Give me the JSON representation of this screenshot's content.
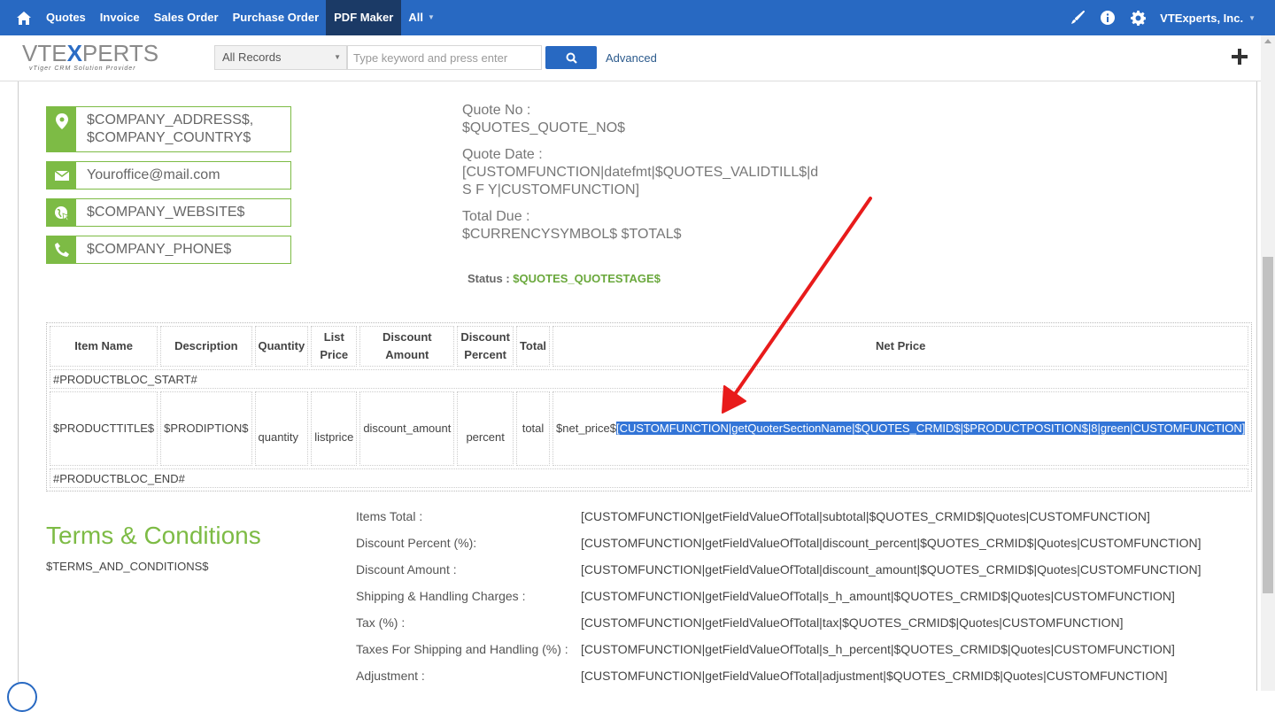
{
  "nav": {
    "items": [
      {
        "label": "Quotes"
      },
      {
        "label": "Invoice"
      },
      {
        "label": "Sales Order"
      },
      {
        "label": "Purchase Order"
      },
      {
        "label": "PDF Maker",
        "active": true
      },
      {
        "label": "All",
        "caret": true
      }
    ],
    "company": "VTExperts, Inc.",
    "icons": [
      "home-icon",
      "brush-icon",
      "info-icon",
      "gear-icon"
    ]
  },
  "subbar": {
    "logo_text_a": "VTE",
    "logo_text_x": "X",
    "logo_text_b": "PERTS",
    "logo_tagline": "vTiger CRM Solution Provider",
    "records_select": "All Records",
    "search_placeholder": "Type keyword and press enter",
    "advanced": "Advanced"
  },
  "contact": {
    "address_line1": "$COMPANY_ADDRESS$,",
    "address_line2": "$COMPANY_COUNTRY$",
    "email": "Youroffice@mail.com",
    "website": "$COMPANY_WEBSITE$",
    "phone": "$COMPANY_PHONE$"
  },
  "quote": {
    "no_label": "Quote No :",
    "no_value": "$QUOTES_QUOTE_NO$",
    "date_label": "Quote Date :",
    "date_value_1": "[CUSTOMFUNCTION|datefmt|$QUOTES_VALIDTILL$|d",
    "date_value_2": "S F Y|CUSTOMFUNCTION]",
    "due_label": "Total Due :",
    "due_value": "$CURRENCYSYMBOL$ $TOTAL$",
    "status_label": "Status :",
    "status_value": "$QUOTES_QUOTESTAGE$"
  },
  "table": {
    "headers": {
      "item_name": "Item Name",
      "description": "Description",
      "quantity": "Quantity",
      "list_price_1": "List",
      "list_price_2": "Price",
      "discount_amount_1": "Discount",
      "discount_amount_2": "Amount",
      "discount_percent_1": "Discount",
      "discount_percent_2": "Percent",
      "total": "Total",
      "net_price": "Net Price"
    },
    "bloc_start": "#PRODUCTBLOC_START#",
    "bloc_end": "#PRODUCTBLOC_END#",
    "row": {
      "title": "$PRODUCTTITLE$",
      "description": "$PRODIPTION$",
      "quantity": "quantity",
      "listprice": "listprice",
      "discount_amount": "discount_amount",
      "percent": "percent",
      "total": "total",
      "net_price_plain": "$net_price$",
      "net_price_selected": "[CUSTOMFUNCTION|getQuoterSectionName|$QUOTES_CRMID$|$PRODUCTPOSITION$|8|green|CUSTOMFUNCTION]"
    }
  },
  "terms": {
    "title": "Terms & Conditions",
    "value": "$TERMS_AND_CONDITIONS$"
  },
  "totals": [
    {
      "label": "Items Total :",
      "value": "[CUSTOMFUNCTION|getFieldValueOfTotal|subtotal|$QUOTES_CRMID$|Quotes|CUSTOMFUNCTION]"
    },
    {
      "label": "Discount Percent (%):",
      "value": "[CUSTOMFUNCTION|getFieldValueOfTotal|discount_percent|$QUOTES_CRMID$|Quotes|CUSTOMFUNCTION]"
    },
    {
      "label": "Discount Amount :",
      "value": "[CUSTOMFUNCTION|getFieldValueOfTotal|discount_amount|$QUOTES_CRMID$|Quotes|CUSTOMFUNCTION]"
    },
    {
      "label": "Shipping & Handling Charges :",
      "value": "[CUSTOMFUNCTION|getFieldValueOfTotal|s_h_amount|$QUOTES_CRMID$|Quotes|CUSTOMFUNCTION]"
    },
    {
      "label": "Tax (%) :",
      "value": "[CUSTOMFUNCTION|getFieldValueOfTotal|tax|$QUOTES_CRMID$|Quotes|CUSTOMFUNCTION]"
    },
    {
      "label": "Taxes For Shipping and Handling (%) :",
      "value": "[CUSTOMFUNCTION|getFieldValueOfTotal|s_h_percent|$QUOTES_CRMID$|Quotes|CUSTOMFUNCTION]"
    },
    {
      "label": "Adjustment :",
      "value": "[CUSTOMFUNCTION|getFieldValueOfTotal|adjustment|$QUOTES_CRMID$|Quotes|CUSTOMFUNCTION]"
    }
  ],
  "colors": {
    "nav_bg": "#2869c2",
    "nav_active": "#1b3a66",
    "green": "#7dbb45",
    "arrow": "#e81b1b",
    "selection": "#3375d7"
  }
}
